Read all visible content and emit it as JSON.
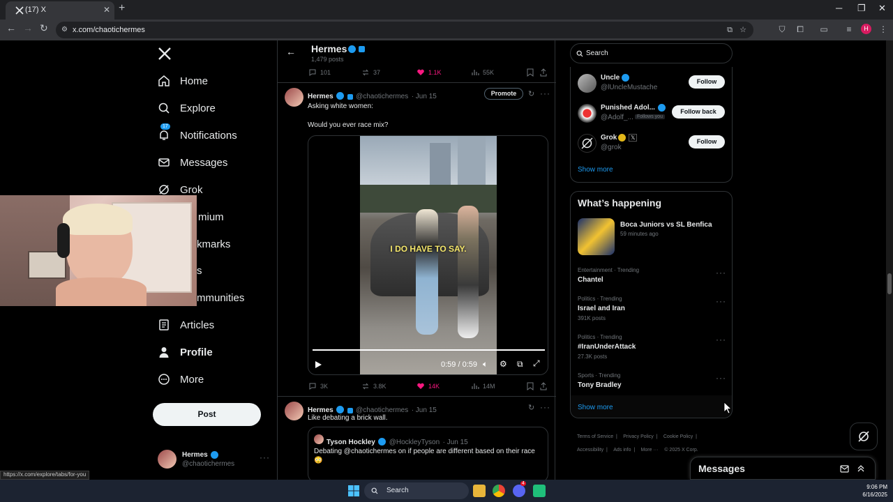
{
  "browser": {
    "tab_title": "(17) X",
    "url": "x.com/chaotichermes",
    "status_url": "https://x.com/explore/tabs/for-you",
    "profile_initial": "H"
  },
  "sidebar": {
    "items": [
      {
        "label": "Home",
        "icon": "home-icon"
      },
      {
        "label": "Explore",
        "icon": "search-icon"
      },
      {
        "label": "Notifications",
        "icon": "bell-icon",
        "badge": "17"
      },
      {
        "label": "Messages",
        "icon": "mail-icon"
      },
      {
        "label": "Grok",
        "icon": "grok-icon"
      },
      {
        "label": "mium",
        "icon": "premium-icon"
      },
      {
        "label": "kmarks",
        "icon": "bookmark-icon"
      },
      {
        "label": "s",
        "icon": "jobs-icon"
      },
      {
        "label": "mmunities",
        "icon": "communities-icon"
      },
      {
        "label": "Articles",
        "icon": "articles-icon"
      },
      {
        "label": "Profile",
        "icon": "person-icon"
      },
      {
        "label": "More",
        "icon": "more-circle-icon"
      }
    ],
    "post_label": "Post",
    "account_name": "Hermes",
    "account_handle": "@chaotichermes"
  },
  "feed": {
    "header_title": "Hermes",
    "header_posts": "1,479 posts",
    "top_actions": {
      "replies": "101",
      "reposts": "37",
      "likes": "1.1K",
      "views": "55K"
    },
    "post1": {
      "name": "Hermes",
      "handle": "@chaotichermes",
      "date": "· Jun 15",
      "promote": "Promote",
      "line1": "Asking white women:",
      "line2": "Would you ever race mix?",
      "video_caption": "I DO HAVE TO SAY.",
      "video_time": "0:59 / 0:59",
      "video_progress": 1.0,
      "replies": "3K",
      "reposts": "3.8K",
      "likes": "14K",
      "views": "14M"
    },
    "post2": {
      "name": "Hermes",
      "handle": "@chaotichermes",
      "date": "· Jun 15",
      "text": "Like debating a brick wall.",
      "quote_name": "Tyson Hockley",
      "quote_handle": "@HockleyTyson",
      "quote_date": "· Jun 15",
      "quote_text": "Debating @chaotichermes on if people are different based on their race",
      "quote_emoji": "😳"
    }
  },
  "right": {
    "search_placeholder": "Search",
    "who_to_follow": [
      {
        "name": "Uncle",
        "handle": "@lUncleMustache",
        "button": "Follow"
      },
      {
        "name": "Punished Adol...",
        "handle": "@Adolf_...",
        "follows_you": "Follows you",
        "button": "Follow back"
      },
      {
        "name": "Grok",
        "handle": "@grok",
        "button": "Follow"
      }
    ],
    "show_more_1": "Show more",
    "happening_title": "What’s happening",
    "featured_title": "Boca Juniors vs SL Benfica",
    "featured_meta": "59 minutes ago",
    "trends": [
      {
        "meta": "Entertainment · Trending",
        "title": "Chantel",
        "count": ""
      },
      {
        "meta": "Politics · Trending",
        "title": "Israel and Iran",
        "count": "391K posts"
      },
      {
        "meta": "Politics · Trending",
        "title": "#IranUnderAttack",
        "count": "27.3K posts"
      },
      {
        "meta": "Sports · Trending",
        "title": "Tony Bradley",
        "count": ""
      }
    ],
    "show_more_2": "Show more",
    "footer": [
      "Terms of Service",
      "Privacy Policy",
      "Cookie Policy",
      "Accessibility",
      "Ads info",
      "More ···",
      "© 2025 X Corp."
    ],
    "messages_title": "Messages"
  },
  "taskbar": {
    "search": "Search",
    "time": "9:06 PM",
    "date": "6/16/2025",
    "discord_badge": "4"
  },
  "colors": {
    "accent": "#1d9bf0",
    "like": "#f91880",
    "gold": "#e2b719"
  }
}
